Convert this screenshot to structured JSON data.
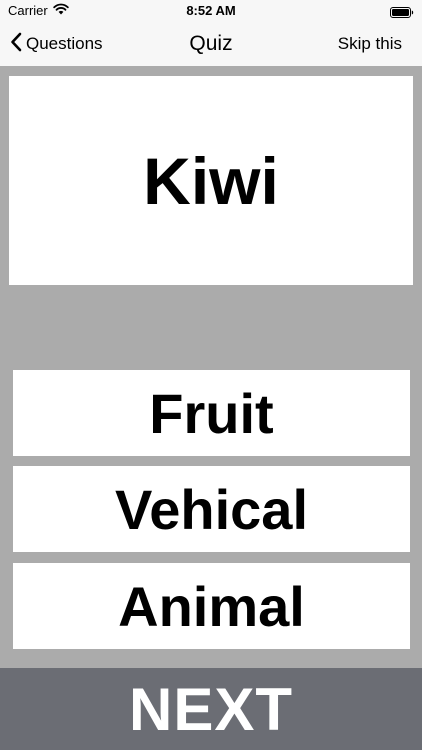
{
  "status_bar": {
    "carrier": "Carrier",
    "time": "8:52 AM",
    "wifi_icon": "wifi-icon",
    "battery_icon": "battery-icon"
  },
  "nav": {
    "back_label": "Questions",
    "back_icon": "chevron-left-icon",
    "title": "Quiz",
    "right_label": "Skip this"
  },
  "question": {
    "text": "Kiwi"
  },
  "answers": [
    {
      "label": "Fruit"
    },
    {
      "label": "Vehical"
    },
    {
      "label": "Animal"
    }
  ],
  "next_button": {
    "label": "NEXT"
  },
  "colors": {
    "background": "#ababab",
    "bars": "#f7f7f7",
    "card": "#ffffff",
    "next_button": "#6b6d74"
  }
}
